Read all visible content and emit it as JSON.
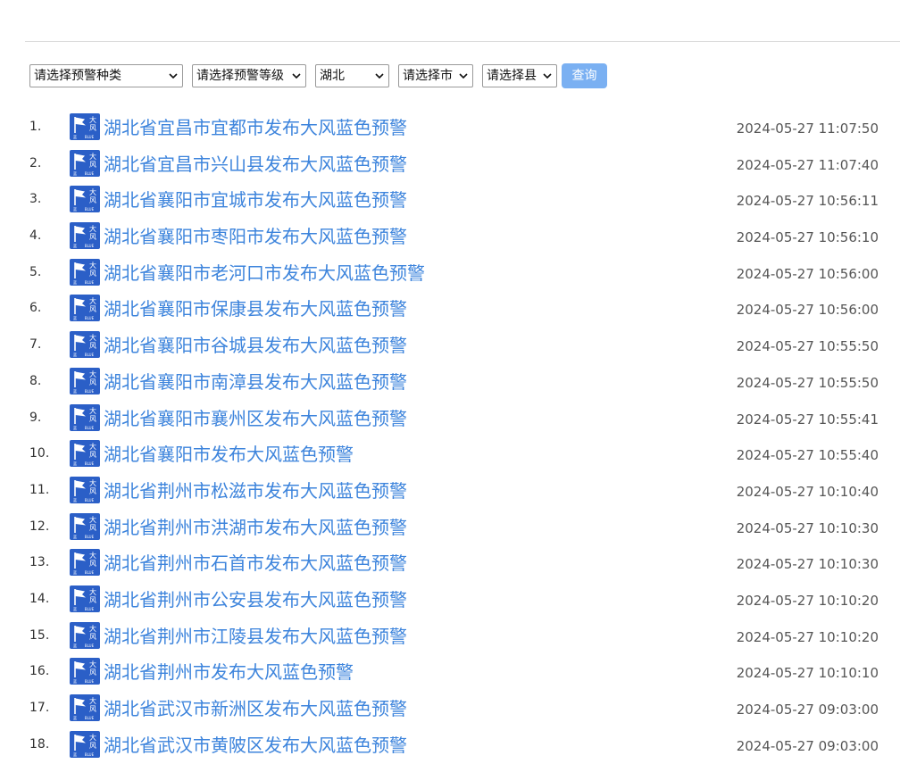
{
  "filters": {
    "type_select": "请选择预警种类",
    "level_select": "请选择预警等级",
    "province_select": "湖北",
    "city_select": "请选择市",
    "county_select": "请选择县",
    "query_button": "查询"
  },
  "colors": {
    "link": "#3d84dc",
    "icon_blue": "#2b5fc7",
    "button": "#7ab0f2"
  },
  "warning_icon": {
    "name": "wind-blue-warning-icon",
    "text_top": "大",
    "text_mid": "风",
    "text_bottom_left": "蓝",
    "text_bottom_right": "BLUE"
  },
  "warnings": [
    {
      "num": "1.",
      "title": "湖北省宜昌市宜都市发布大风蓝色预警",
      "time": "2024-05-27 11:07:50"
    },
    {
      "num": "2.",
      "title": "湖北省宜昌市兴山县发布大风蓝色预警",
      "time": "2024-05-27 11:07:40"
    },
    {
      "num": "3.",
      "title": "湖北省襄阳市宜城市发布大风蓝色预警",
      "time": "2024-05-27 10:56:11"
    },
    {
      "num": "4.",
      "title": "湖北省襄阳市枣阳市发布大风蓝色预警",
      "time": "2024-05-27 10:56:10"
    },
    {
      "num": "5.",
      "title": "湖北省襄阳市老河口市发布大风蓝色预警",
      "time": "2024-05-27 10:56:00"
    },
    {
      "num": "6.",
      "title": "湖北省襄阳市保康县发布大风蓝色预警",
      "time": "2024-05-27 10:56:00"
    },
    {
      "num": "7.",
      "title": "湖北省襄阳市谷城县发布大风蓝色预警",
      "time": "2024-05-27 10:55:50"
    },
    {
      "num": "8.",
      "title": "湖北省襄阳市南漳县发布大风蓝色预警",
      "time": "2024-05-27 10:55:50"
    },
    {
      "num": "9.",
      "title": "湖北省襄阳市襄州区发布大风蓝色预警",
      "time": "2024-05-27 10:55:41"
    },
    {
      "num": "10.",
      "title": "湖北省襄阳市发布大风蓝色预警",
      "time": "2024-05-27 10:55:40"
    },
    {
      "num": "11.",
      "title": "湖北省荆州市松滋市发布大风蓝色预警",
      "time": "2024-05-27 10:10:40"
    },
    {
      "num": "12.",
      "title": "湖北省荆州市洪湖市发布大风蓝色预警",
      "time": "2024-05-27 10:10:30"
    },
    {
      "num": "13.",
      "title": "湖北省荆州市石首市发布大风蓝色预警",
      "time": "2024-05-27 10:10:30"
    },
    {
      "num": "14.",
      "title": "湖北省荆州市公安县发布大风蓝色预警",
      "time": "2024-05-27 10:10:20"
    },
    {
      "num": "15.",
      "title": "湖北省荆州市江陵县发布大风蓝色预警",
      "time": "2024-05-27 10:10:20"
    },
    {
      "num": "16.",
      "title": "湖北省荆州市发布大风蓝色预警",
      "time": "2024-05-27 10:10:10"
    },
    {
      "num": "17.",
      "title": "湖北省武汉市新洲区发布大风蓝色预警",
      "time": "2024-05-27 09:03:00"
    },
    {
      "num": "18.",
      "title": "湖北省武汉市黄陂区发布大风蓝色预警",
      "time": "2024-05-27 09:03:00"
    }
  ]
}
